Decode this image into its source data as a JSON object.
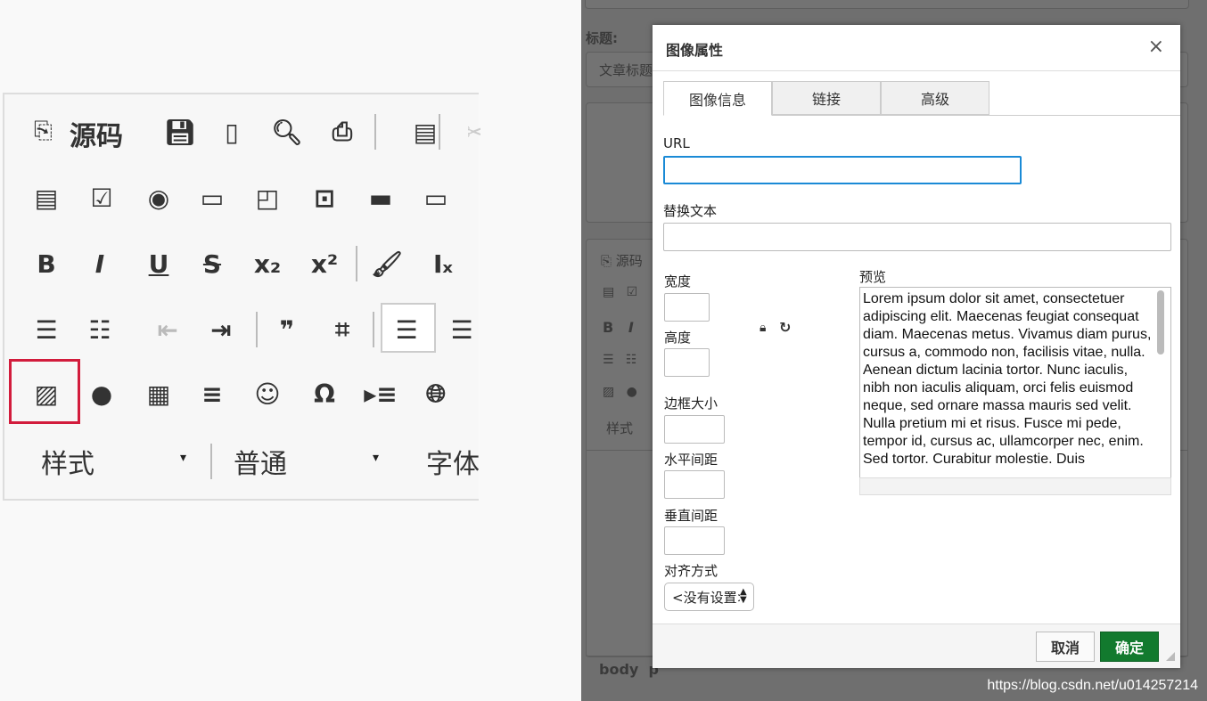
{
  "toolbar": {
    "source_label": "源码",
    "rows": [
      [
        "source",
        "save",
        "new-page",
        "preview",
        "print",
        "templates",
        "cut"
      ],
      [
        "form",
        "checkbox",
        "radio",
        "text-field",
        "textarea",
        "select",
        "button",
        "image-button"
      ],
      [
        "bold",
        "italic",
        "underline",
        "strike",
        "subscript",
        "superscript",
        "copy-format",
        "remove-format"
      ],
      [
        "numbered-list",
        "bulleted-list",
        "outdent",
        "indent",
        "blockquote",
        "div",
        "align-left",
        "align-center"
      ],
      [
        "image",
        "flash",
        "table",
        "horizontal-rule",
        "smiley",
        "special-char",
        "page-break",
        "iframe"
      ]
    ],
    "highlight_color": "#d21c3c",
    "styles_label": "样式",
    "format_label": "普通",
    "font_label": "字体"
  },
  "background": {
    "title_label": "标题:",
    "title_placeholder": "文章标题",
    "source_label": "源码",
    "styles_label": "样式",
    "path": [
      "body",
      "p"
    ]
  },
  "dialog": {
    "title": "图像属性",
    "close": "×",
    "tabs": [
      {
        "label": "图像信息",
        "active": true
      },
      {
        "label": "链接"
      },
      {
        "label": "高级"
      }
    ],
    "url_label": "URL",
    "url_value": "",
    "alt_label": "替换文本",
    "alt_value": "",
    "width_label": "宽度",
    "height_label": "高度",
    "border_label": "边框大小",
    "hspace_label": "水平间距",
    "vspace_label": "垂直间距",
    "align_label": "对齐方式",
    "align_value": "<没有设置>",
    "preview_label": "预览",
    "preview_text": "Lorem ipsum dolor sit amet, consectetuer adipiscing elit. Maecenas feugiat consequat diam. Maecenas metus. Vivamus diam purus, cursus a, commodo non, facilisis vitae, nulla. Aenean dictum lacinia tortor. Nunc iaculis, nibh non iaculis aliquam, orci felis euismod neque, sed ornare massa mauris sed velit. Nulla pretium mi et risus. Fusce mi pede, tempor id, cursus ac, ullamcorper nec, enim. Sed tortor. Curabitur molestie. Duis",
    "cancel_label": "取消",
    "ok_label": "确定",
    "ok_color": "#127a2e",
    "focus_color": "#1a8ad6"
  },
  "watermark": "https://blog.csdn.net/u014257214"
}
